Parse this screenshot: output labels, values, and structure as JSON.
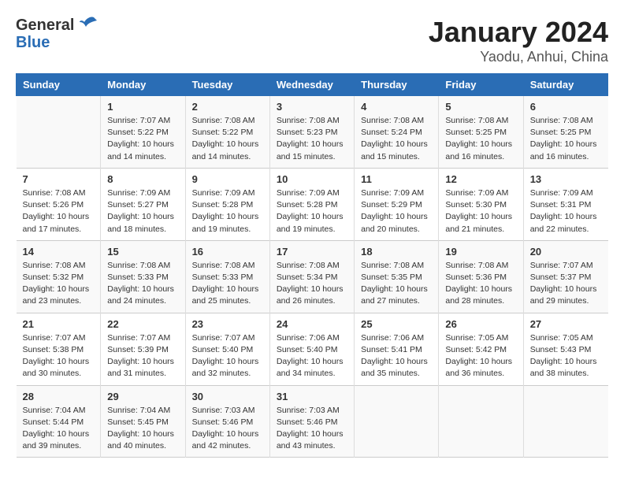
{
  "logo": {
    "general": "General",
    "blue": "Blue"
  },
  "title": "January 2024",
  "subtitle": "Yaodu, Anhui, China",
  "headers": [
    "Sunday",
    "Monday",
    "Tuesday",
    "Wednesday",
    "Thursday",
    "Friday",
    "Saturday"
  ],
  "weeks": [
    [
      {
        "num": "",
        "info": ""
      },
      {
        "num": "1",
        "info": "Sunrise: 7:07 AM\nSunset: 5:22 PM\nDaylight: 10 hours\nand 14 minutes."
      },
      {
        "num": "2",
        "info": "Sunrise: 7:08 AM\nSunset: 5:22 PM\nDaylight: 10 hours\nand 14 minutes."
      },
      {
        "num": "3",
        "info": "Sunrise: 7:08 AM\nSunset: 5:23 PM\nDaylight: 10 hours\nand 15 minutes."
      },
      {
        "num": "4",
        "info": "Sunrise: 7:08 AM\nSunset: 5:24 PM\nDaylight: 10 hours\nand 15 minutes."
      },
      {
        "num": "5",
        "info": "Sunrise: 7:08 AM\nSunset: 5:25 PM\nDaylight: 10 hours\nand 16 minutes."
      },
      {
        "num": "6",
        "info": "Sunrise: 7:08 AM\nSunset: 5:25 PM\nDaylight: 10 hours\nand 16 minutes."
      }
    ],
    [
      {
        "num": "7",
        "info": "Sunrise: 7:08 AM\nSunset: 5:26 PM\nDaylight: 10 hours\nand 17 minutes."
      },
      {
        "num": "8",
        "info": "Sunrise: 7:09 AM\nSunset: 5:27 PM\nDaylight: 10 hours\nand 18 minutes."
      },
      {
        "num": "9",
        "info": "Sunrise: 7:09 AM\nSunset: 5:28 PM\nDaylight: 10 hours\nand 19 minutes."
      },
      {
        "num": "10",
        "info": "Sunrise: 7:09 AM\nSunset: 5:28 PM\nDaylight: 10 hours\nand 19 minutes."
      },
      {
        "num": "11",
        "info": "Sunrise: 7:09 AM\nSunset: 5:29 PM\nDaylight: 10 hours\nand 20 minutes."
      },
      {
        "num": "12",
        "info": "Sunrise: 7:09 AM\nSunset: 5:30 PM\nDaylight: 10 hours\nand 21 minutes."
      },
      {
        "num": "13",
        "info": "Sunrise: 7:09 AM\nSunset: 5:31 PM\nDaylight: 10 hours\nand 22 minutes."
      }
    ],
    [
      {
        "num": "14",
        "info": "Sunrise: 7:08 AM\nSunset: 5:32 PM\nDaylight: 10 hours\nand 23 minutes."
      },
      {
        "num": "15",
        "info": "Sunrise: 7:08 AM\nSunset: 5:33 PM\nDaylight: 10 hours\nand 24 minutes."
      },
      {
        "num": "16",
        "info": "Sunrise: 7:08 AM\nSunset: 5:33 PM\nDaylight: 10 hours\nand 25 minutes."
      },
      {
        "num": "17",
        "info": "Sunrise: 7:08 AM\nSunset: 5:34 PM\nDaylight: 10 hours\nand 26 minutes."
      },
      {
        "num": "18",
        "info": "Sunrise: 7:08 AM\nSunset: 5:35 PM\nDaylight: 10 hours\nand 27 minutes."
      },
      {
        "num": "19",
        "info": "Sunrise: 7:08 AM\nSunset: 5:36 PM\nDaylight: 10 hours\nand 28 minutes."
      },
      {
        "num": "20",
        "info": "Sunrise: 7:07 AM\nSunset: 5:37 PM\nDaylight: 10 hours\nand 29 minutes."
      }
    ],
    [
      {
        "num": "21",
        "info": "Sunrise: 7:07 AM\nSunset: 5:38 PM\nDaylight: 10 hours\nand 30 minutes."
      },
      {
        "num": "22",
        "info": "Sunrise: 7:07 AM\nSunset: 5:39 PM\nDaylight: 10 hours\nand 31 minutes."
      },
      {
        "num": "23",
        "info": "Sunrise: 7:07 AM\nSunset: 5:40 PM\nDaylight: 10 hours\nand 32 minutes."
      },
      {
        "num": "24",
        "info": "Sunrise: 7:06 AM\nSunset: 5:40 PM\nDaylight: 10 hours\nand 34 minutes."
      },
      {
        "num": "25",
        "info": "Sunrise: 7:06 AM\nSunset: 5:41 PM\nDaylight: 10 hours\nand 35 minutes."
      },
      {
        "num": "26",
        "info": "Sunrise: 7:05 AM\nSunset: 5:42 PM\nDaylight: 10 hours\nand 36 minutes."
      },
      {
        "num": "27",
        "info": "Sunrise: 7:05 AM\nSunset: 5:43 PM\nDaylight: 10 hours\nand 38 minutes."
      }
    ],
    [
      {
        "num": "28",
        "info": "Sunrise: 7:04 AM\nSunset: 5:44 PM\nDaylight: 10 hours\nand 39 minutes."
      },
      {
        "num": "29",
        "info": "Sunrise: 7:04 AM\nSunset: 5:45 PM\nDaylight: 10 hours\nand 40 minutes."
      },
      {
        "num": "30",
        "info": "Sunrise: 7:03 AM\nSunset: 5:46 PM\nDaylight: 10 hours\nand 42 minutes."
      },
      {
        "num": "31",
        "info": "Sunrise: 7:03 AM\nSunset: 5:46 PM\nDaylight: 10 hours\nand 43 minutes."
      },
      {
        "num": "",
        "info": ""
      },
      {
        "num": "",
        "info": ""
      },
      {
        "num": "",
        "info": ""
      }
    ]
  ]
}
